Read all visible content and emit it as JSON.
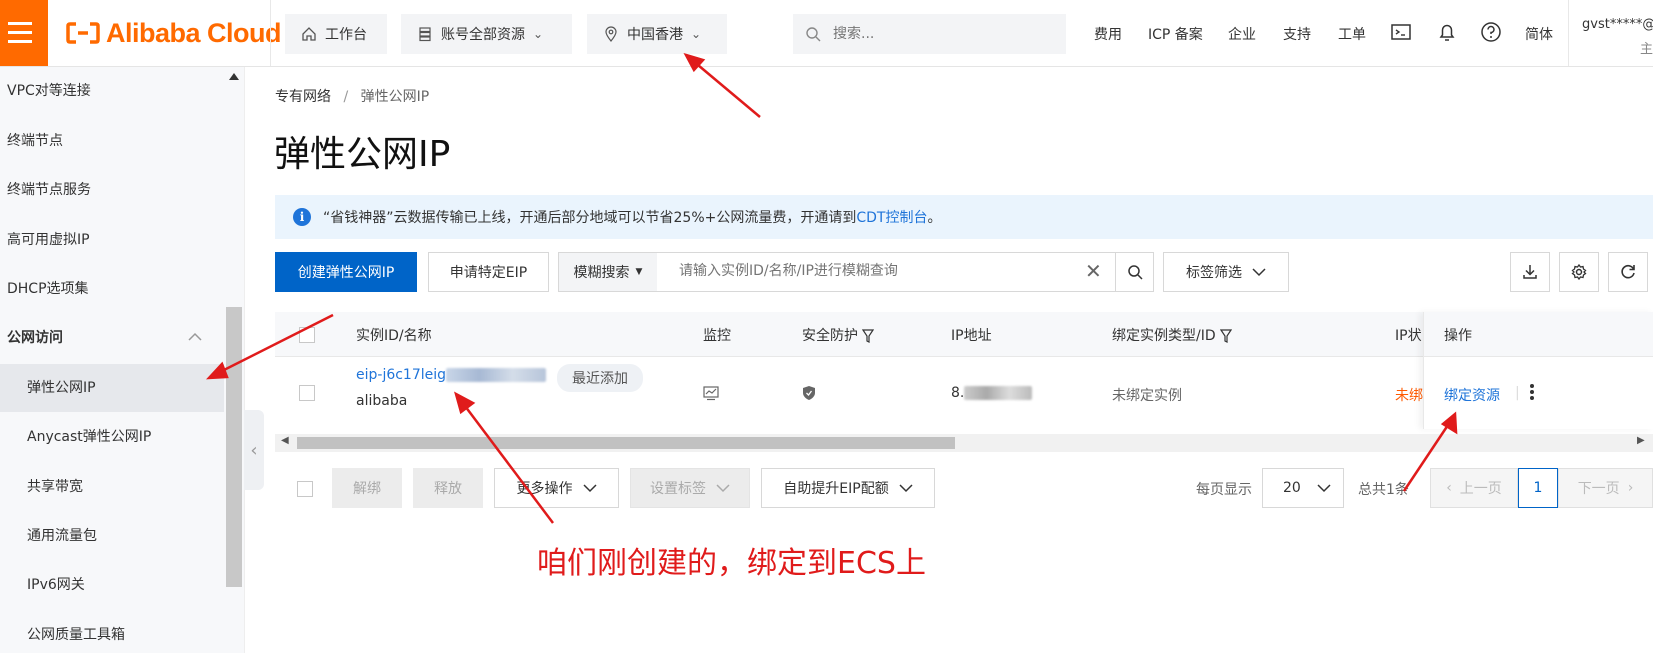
{
  "header": {
    "logo_text": "Alibaba Cloud",
    "workbench": "工作台",
    "resource_group": "账号全部资源",
    "region": "中国香港",
    "search_placeholder": "搜索...",
    "links": [
      "费用",
      "ICP 备案",
      "企业",
      "支持",
      "工单"
    ],
    "language": "简体",
    "account": "gvst*****@",
    "account_sub": "主"
  },
  "sidebar": {
    "items": [
      {
        "label": "VPC对等连接"
      },
      {
        "label": "终端节点"
      },
      {
        "label": "终端节点服务"
      },
      {
        "label": "高可用虚拟IP"
      },
      {
        "label": "DHCP选项集"
      }
    ],
    "group": {
      "label": "公网访问"
    },
    "sub_items": [
      {
        "label": "弹性公网IP"
      },
      {
        "label": "Anycast弹性公网IP"
      },
      {
        "label": "共享带宽"
      },
      {
        "label": "通用流量包"
      },
      {
        "label": "IPv6网关"
      },
      {
        "label": "公网质量工具箱"
      }
    ]
  },
  "breadcrumb": {
    "parent": "专有网络",
    "separator": "/",
    "current": "弹性公网IP"
  },
  "page_title": "弹性公网IP",
  "notice": {
    "text": "“省钱神器”云数据传输已上线，开通后部分地域可以节省25%+公网流量费，开通请到",
    "link": "CDT控制台",
    "suffix": "。"
  },
  "toolbar": {
    "create": "创建弹性公网IP",
    "apply_specific": "申请特定EIP",
    "search_mode": "模糊搜索",
    "search_placeholder": "请输入实例ID/名称/IP进行模糊查询",
    "tag_filter": "标签筛选"
  },
  "table": {
    "columns": [
      "实例ID/名称",
      "监控",
      "安全防护",
      "IP地址",
      "绑定实例类型/ID",
      "IP状",
      "操作"
    ],
    "rows": [
      {
        "id": "eip-j6c17leig",
        "name": "alibaba",
        "badge": "最近添加",
        "ip": "8.",
        "bind_status": "未绑定实例",
        "ip_status": "未绑",
        "action": "绑定资源"
      }
    ]
  },
  "bottom_bar": {
    "unbind": "解绑",
    "release": "释放",
    "more": "更多操作",
    "set_tags": "设置标签",
    "raise_quota": "自助提升EIP配额",
    "page_size_label": "每页显示",
    "page_size": "20",
    "total": "总共1条",
    "prev": "上一页",
    "current_page": "1",
    "next": "下一页"
  },
  "annotation": {
    "text": "咱们刚创建的，绑定到ECS上",
    "color": "#e01b1b"
  },
  "colors": {
    "brand": "#ff6a00",
    "primary": "#0064c8",
    "link": "#1f74d9",
    "warning": "#ff5a00"
  }
}
